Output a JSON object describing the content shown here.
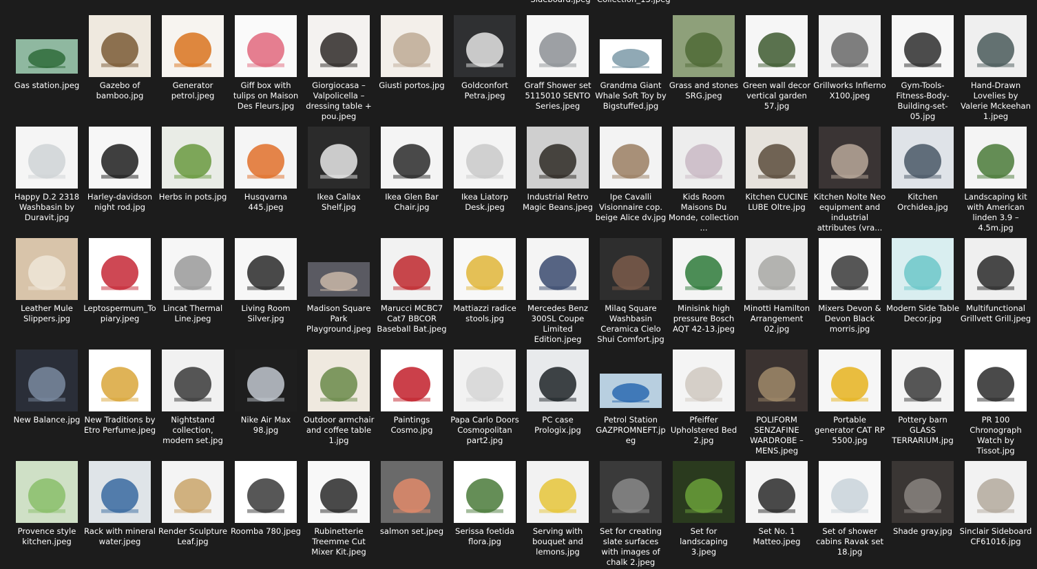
{
  "partial_labels": [
    "Sideboard.jpeg",
    "Collection_13.jpeg"
  ],
  "rows": [
    [
      {
        "name": "Gas station.jpeg",
        "bg": "#8fb8a0",
        "fg": "#2f6b3a",
        "shape": "wide"
      },
      {
        "name": "Gazebo of bamboo.jpg",
        "bg": "#efe9df",
        "fg": "#7a5a36",
        "shape": "square"
      },
      {
        "name": "Generator petrol.jpeg",
        "bg": "#f7f4f0",
        "fg": "#d9731e",
        "shape": "square"
      },
      {
        "name": "Giff box with tulips on Maison Des Fleurs.jpg",
        "bg": "#fafafa",
        "fg": "#e0677c",
        "shape": "square"
      },
      {
        "name": "Giorgiocasa – Valpolicella – dressing table + pou.jpeg",
        "bg": "#f4f2f0",
        "fg": "#2e2a28",
        "shape": "square"
      },
      {
        "name": "Giusti portos.jpg",
        "bg": "#f3efea",
        "fg": "#bdaa95",
        "shape": "square"
      },
      {
        "name": "Goldconfort Petra.jpeg",
        "bg": "#2f3032",
        "fg": "#e4e4e4",
        "shape": "square"
      },
      {
        "name": "Graff Shower set 5115010 SENTO Series.jpeg",
        "bg": "#f6f6f6",
        "fg": "#8d9195",
        "shape": "square"
      },
      {
        "name": "Grandma Giant Whale Soft Toy by Bigstuffed.jpg",
        "bg": "#ffffff",
        "fg": "#7d9aa8",
        "shape": "wide"
      },
      {
        "name": "Grass and stones SRG.jpeg",
        "bg": "#8ea07a",
        "fg": "#4f6a36",
        "shape": "square"
      },
      {
        "name": "Green wall decor vertical garden 57.jpg",
        "bg": "#f6f6f6",
        "fg": "#3e5a30",
        "shape": "square"
      },
      {
        "name": "Grillworks Infierno X100.jpeg",
        "bg": "#f2f2f2",
        "fg": "#6a6a6a",
        "shape": "square"
      },
      {
        "name": "Gym-Tools-Fitness-Body-Building-set-05.jpg",
        "bg": "#f7f7f7",
        "fg": "#2e2e2e",
        "shape": "square"
      },
      {
        "name": "Hand-Drawn Lovelies by Valerie Mckeehan 1.jpeg",
        "bg": "#efefef",
        "fg": "#4a5a5a",
        "shape": "square"
      }
    ],
    [
      {
        "name": "Happy D.2 2318 Washbasin by Duravit.jpg",
        "bg": "#f5f5f5",
        "fg": "#cfd3d6",
        "shape": "square"
      },
      {
        "name": "Harley-davidson night rod.jpg",
        "bg": "#f7f7f7",
        "fg": "#1e1e1e",
        "shape": "square"
      },
      {
        "name": "Herbs in pots.jpg",
        "bg": "#e9ece6",
        "fg": "#6a9a40",
        "shape": "square"
      },
      {
        "name": "Husqvarna 445.jpeg",
        "bg": "#f5f5f5",
        "fg": "#e0702a",
        "shape": "square"
      },
      {
        "name": "Ikea Callax Shelf.jpg",
        "bg": "#2b2b2b",
        "fg": "#e8e8e8",
        "shape": "square"
      },
      {
        "name": "Ikea Glen Bar Chair.jpg",
        "bg": "#f4f4f4",
        "fg": "#2a2a2a",
        "shape": "square"
      },
      {
        "name": "Ikea Liatorp Desk.jpeg",
        "bg": "#f4f4f4",
        "fg": "#c9c9c9",
        "shape": "square"
      },
      {
        "name": "Industrial Retro Magic Beans.jpeg",
        "bg": "#cfcfcf",
        "fg": "#2e2a24",
        "shape": "square"
      },
      {
        "name": "Ipe Cavalli Visionnaire cop. beige Alice dv.jpg",
        "bg": "#f3f3f3",
        "fg": "#9a7e62",
        "shape": "square"
      },
      {
        "name": "Kids Room Maisons Du Monde, collection ...",
        "bg": "#ededed",
        "fg": "#c9b9c4",
        "shape": "square"
      },
      {
        "name": "Kitchen CUCINE LUBE Oltre.jpg",
        "bg": "#e6e2dc",
        "fg": "#5a4c3c",
        "shape": "square"
      },
      {
        "name": "Kitchen Nolte Neo equipment and industrial attributes (vra...",
        "bg": "#3a3434",
        "fg": "#b8a89a",
        "shape": "square"
      },
      {
        "name": "Kitchen Orchidea.jpg",
        "bg": "#dfe3e8",
        "fg": "#4a5866",
        "shape": "square"
      },
      {
        "name": "Landscaping kit with American linden 3.9 – 4.5m.jpg",
        "bg": "#f4f4f4",
        "fg": "#4a7a38",
        "shape": "square"
      }
    ],
    [
      {
        "name": "Leather Mule Slippers.jpg",
        "bg": "#d8c4aa",
        "fg": "#efe6d8",
        "shape": "square"
      },
      {
        "name": "Leptospermum_Topiary.jpeg",
        "bg": "#ffffff",
        "fg": "#c62836",
        "shape": "square"
      },
      {
        "name": "Lincat Thermal Line.jpeg",
        "bg": "#f6f6f6",
        "fg": "#9a9a9a",
        "shape": "square"
      },
      {
        "name": "Living Room Silver.jpg",
        "bg": "#f7f7f7",
        "fg": "#2a2a2a",
        "shape": "square"
      },
      {
        "name": "Madison Square Park Playground.jpeg",
        "bg": "#5a5a62",
        "fg": "#c9b7a8",
        "shape": "wide"
      },
      {
        "name": "Marucci MCBC7 Cat7 BBCOR Baseball Bat.jpeg",
        "bg": "#f2f2f2",
        "fg": "#c0282e",
        "shape": "square"
      },
      {
        "name": "Mattiazzi radice stools.jpg",
        "bg": "#f8f8f8",
        "fg": "#e1b63a",
        "shape": "square"
      },
      {
        "name": "Mercedes Benz 300SL Coupe Limited Edition.jpeg",
        "bg": "#f4f4f4",
        "fg": "#3a4a6e",
        "shape": "square"
      },
      {
        "name": "Milaq Square Washbasin Ceramica Cielo Shui Comfort.jpg",
        "bg": "#2e2e2e",
        "fg": "#7a5a4a",
        "shape": "square"
      },
      {
        "name": "Minisink high pressure Bosch AQT 42-13.jpeg",
        "bg": "#f4f4f4",
        "fg": "#2e7a3a",
        "shape": "square"
      },
      {
        "name": "Minotti Hamilton Arrangement 02.jpg",
        "bg": "#eeeeee",
        "fg": "#a8a8a4",
        "shape": "square"
      },
      {
        "name": "Mixers Devon & Devon Black morris.jpg",
        "bg": "#f8f8f8",
        "fg": "#3a3a3a",
        "shape": "square"
      },
      {
        "name": "Modern Side Table Decor.jpg",
        "bg": "#d9eef0",
        "fg": "#6cc7c9",
        "shape": "square"
      },
      {
        "name": "Multifunctional Grillvett Grill.jpeg",
        "bg": "#efefef",
        "fg": "#2a2a2a",
        "shape": "square"
      }
    ],
    [
      {
        "name": "New Balance.jpg",
        "bg": "#2a2e38",
        "fg": "#7a8aa0",
        "shape": "square"
      },
      {
        "name": "New Traditions by Etro Perfume.jpeg",
        "bg": "#ffffff",
        "fg": "#d9a63a",
        "shape": "square"
      },
      {
        "name": "Nightstand collection, modern set.jpg",
        "bg": "#f1f1f1",
        "fg": "#3a3a3a",
        "shape": "square"
      },
      {
        "name": "Nike Air Max 98.jpg",
        "bg": "#1e1e1e",
        "fg": "#c2c8d0",
        "shape": "square"
      },
      {
        "name": "Outdoor armchair and coffee table 1.jpg",
        "bg": "#efe9df",
        "fg": "#6a8a4a",
        "shape": "square"
      },
      {
        "name": "Paintings Cosmo.jpg",
        "bg": "#ffffff",
        "fg": "#c21f2a",
        "shape": "square"
      },
      {
        "name": "Papa Carlo Doors Cosmopolitan part2.jpg",
        "bg": "#f2f2f2",
        "fg": "#d6d6d6",
        "shape": "square"
      },
      {
        "name": "PC case Prologix.jpg",
        "bg": "#e8eaec",
        "fg": "#1e2428",
        "shape": "square"
      },
      {
        "name": "Petrol Station GAZPROMNEFT.jpeg",
        "bg": "#b8cfe0",
        "fg": "#2a6ab0",
        "shape": "wide"
      },
      {
        "name": "Pfeiffer Upholstered Bed 2.jpg",
        "bg": "#f4f4f4",
        "fg": "#cfc8bf",
        "shape": "square"
      },
      {
        "name": "POLIFORM SENZAFINE WARDROBE – MENS.jpeg",
        "bg": "#3a3230",
        "fg": "#a08a6a",
        "shape": "square"
      },
      {
        "name": "Portable generator CAT RP 5500.jpg",
        "bg": "#f6f6f6",
        "fg": "#e6b31e",
        "shape": "square"
      },
      {
        "name": "Pottery barn GLASS TERRARIUM.jpg",
        "bg": "#f4f4f4",
        "fg": "#3a3a3a",
        "shape": "square"
      },
      {
        "name": "PR 100 Chronograph Watch by Tissot.jpg",
        "bg": "#ffffff",
        "fg": "#2a2a2a",
        "shape": "square"
      }
    ],
    [
      {
        "name": "Provence style kitchen.jpeg",
        "bg": "#cfe0c6",
        "fg": "#8abe6a",
        "shape": "square"
      },
      {
        "name": "Rack with mineral water.jpeg",
        "bg": "#dfe4e8",
        "fg": "#3a6aa0",
        "shape": "square"
      },
      {
        "name": "Render Sculpture Leaf.jpg",
        "bg": "#f4f4f4",
        "fg": "#c9a46a",
        "shape": "square"
      },
      {
        "name": "Roomba 780.jpeg",
        "bg": "#ffffff",
        "fg": "#3a3a3a",
        "shape": "square"
      },
      {
        "name": "Rubinetterie Treemme Cut Mixer Kit.jpeg",
        "bg": "#f8f8f8",
        "fg": "#2a2a2a",
        "shape": "square"
      },
      {
        "name": "salmon set.jpeg",
        "bg": "#6a6a6a",
        "fg": "#e08a6a",
        "shape": "square"
      },
      {
        "name": "Serissa foetida flora.jpg",
        "bg": "#ffffff",
        "fg": "#4a7a3a",
        "shape": "square"
      },
      {
        "name": "Serving with bouquet and lemons.jpg",
        "bg": "#f2f2f2",
        "fg": "#e6c63a",
        "shape": "square"
      },
      {
        "name": "Set for creating slate surfaces with images of chalk 2.jpeg",
        "bg": "#3a3a3a",
        "fg": "#8a8a8a",
        "shape": "square"
      },
      {
        "name": "Set for landscaping 3.jpeg",
        "bg": "#2a3a1e",
        "fg": "#6aa03a",
        "shape": "square"
      },
      {
        "name": "Set No. 1 Matteo.jpeg",
        "bg": "#f4f4f4",
        "fg": "#2a2a2a",
        "shape": "square"
      },
      {
        "name": "Set of shower cabins Ravak set 18.jpg",
        "bg": "#f8f8f8",
        "fg": "#c9d3da",
        "shape": "square"
      },
      {
        "name": "Shade gray.jpg",
        "bg": "#3a3634",
        "fg": "#8a8480",
        "shape": "square"
      },
      {
        "name": "Sinclair Sideboard CF61016.jpg",
        "bg": "#f2f2f2",
        "fg": "#b4aa9e",
        "shape": "square"
      }
    ]
  ]
}
